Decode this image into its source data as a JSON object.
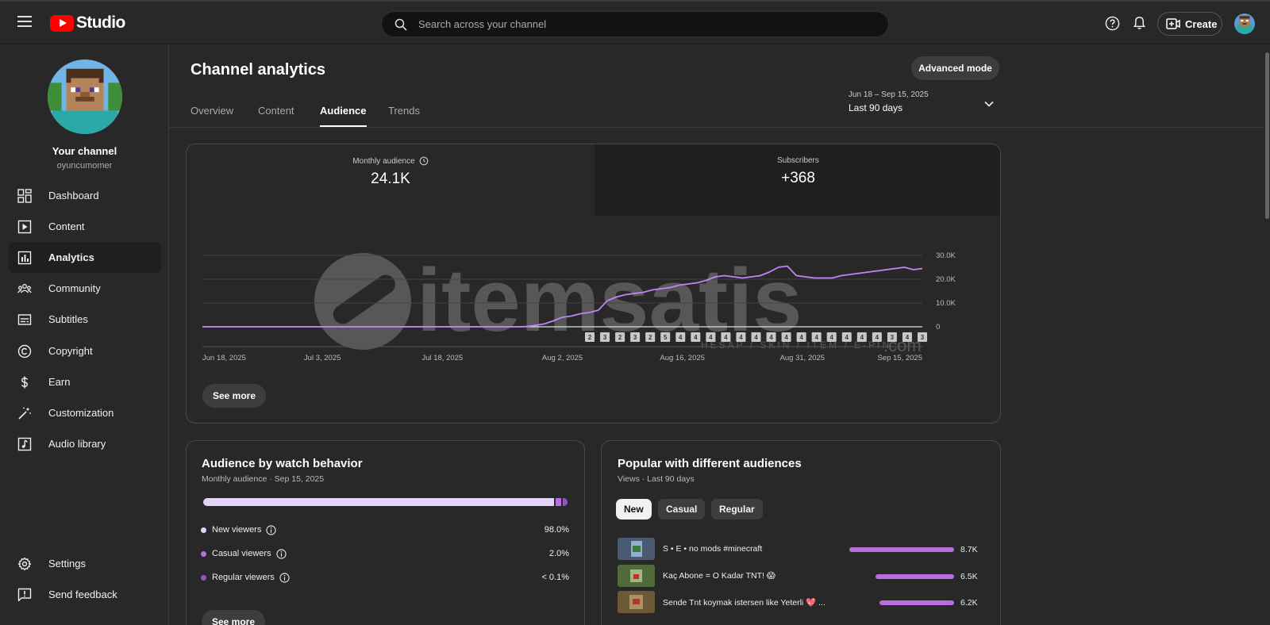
{
  "app": {
    "logo_text": "Studio"
  },
  "search": {
    "placeholder": "Search across your channel"
  },
  "topbar": {
    "create_label": "Create"
  },
  "channel": {
    "title": "Your channel",
    "handle": "oyuncumomer"
  },
  "sidebar": {
    "items": [
      {
        "label": "Dashboard",
        "icon": "dashboard-icon"
      },
      {
        "label": "Content",
        "icon": "content-icon"
      },
      {
        "label": "Analytics",
        "icon": "analytics-icon",
        "active": true
      },
      {
        "label": "Community",
        "icon": "community-icon"
      },
      {
        "label": "Subtitles",
        "icon": "subtitles-icon"
      },
      {
        "label": "Copyright",
        "icon": "copyright-icon"
      },
      {
        "label": "Earn",
        "icon": "dollar-icon"
      },
      {
        "label": "Customization",
        "icon": "magic-wand-icon"
      },
      {
        "label": "Audio library",
        "icon": "audio-library-icon"
      }
    ],
    "settings_label": "Settings",
    "feedback_label": "Send feedback"
  },
  "header": {
    "title": "Channel analytics",
    "advanced_label": "Advanced mode",
    "tabs": [
      {
        "label": "Overview"
      },
      {
        "label": "Content"
      },
      {
        "label": "Audience",
        "active": true
      },
      {
        "label": "Trends"
      }
    ],
    "date_range": "Jun 18 – Sep 15, 2025",
    "date_preset": "Last 90 days"
  },
  "metrics": {
    "monthly_label": "Monthly audience",
    "monthly_value": "24.1K",
    "subs_label": "Subscribers",
    "subs_value": "+368",
    "see_more": "See more"
  },
  "chart_data": {
    "type": "line",
    "x_tick_labels": [
      "Jun 18, 2025",
      "Jul 3, 2025",
      "Jul 18, 2025",
      "Aug 2, 2025",
      "Aug 16, 2025",
      "Aug 31, 2025",
      "Sep 15, 2025"
    ],
    "y_tick_labels": [
      "30.0K",
      "20.0K",
      "10.0K",
      "0"
    ],
    "ylim": [
      0,
      30000
    ],
    "series": [
      {
        "color": "#c084fc",
        "values": [
          0,
          0,
          0,
          0,
          0,
          0,
          0,
          0,
          0,
          0,
          0,
          0,
          0,
          0,
          0,
          0,
          0,
          0,
          0,
          0,
          0,
          0,
          0,
          0,
          0,
          0,
          0,
          0,
          0,
          0,
          0,
          0,
          0,
          0,
          0,
          0,
          100,
          600,
          1200,
          2500,
          4000,
          4500,
          5500,
          6000,
          7000,
          11000,
          12500,
          13500,
          14000,
          14500,
          15500,
          16000,
          16500,
          17500,
          18000,
          18500,
          19500,
          21000,
          21500,
          21000,
          20500,
          21000,
          21500,
          23000,
          25000,
          25500,
          21500,
          21000,
          20500,
          20500,
          20500,
          21500,
          22000,
          22500,
          23000,
          23500,
          24000,
          24500,
          25000,
          24000,
          24500
        ]
      }
    ],
    "badges": [
      "2",
      "3",
      "2",
      "3",
      "2",
      "5",
      "4",
      "4",
      "4",
      "4",
      "4",
      "4",
      "4",
      "4",
      "4",
      "4",
      "4",
      "4",
      "4",
      "4",
      "3",
      "4",
      "3"
    ],
    "legend": "none",
    "grid": true
  },
  "behavior": {
    "title": "Audience by watch behavior",
    "subtitle": "Monthly audience · Sep 15, 2025",
    "shares": [
      98.0,
      1.6,
      0.4
    ],
    "rows": [
      {
        "label": "New viewers",
        "value": "98.0%",
        "color": "#e4d4f7"
      },
      {
        "label": "Casual viewers",
        "value": "2.0%",
        "color": "#b86ee0"
      },
      {
        "label": "Regular viewers",
        "value": "< 0.1%",
        "color": "#9553c6"
      }
    ],
    "see_more": "See more"
  },
  "popular": {
    "title": "Popular with different audiences",
    "subtitle": "Views · Last 90 days",
    "chips": [
      "New",
      "Casual",
      "Regular"
    ],
    "videos": [
      {
        "title": "S • E • no mods #minecraft",
        "views": "8.7K",
        "value": 8700
      },
      {
        "title": "Kaç Abone = O Kadar TNT! 😱",
        "views": "6.5K",
        "value": 6500
      },
      {
        "title": "Sende Tnt koymak istersen like Yeterli 💖 ...",
        "views": "6.2K",
        "value": 6200
      }
    ]
  },
  "watermark": {
    "brand": "itemsatis",
    "tagline": "HESAP / SKIN / ITEM / E-PIN",
    "suffix": ".com"
  }
}
